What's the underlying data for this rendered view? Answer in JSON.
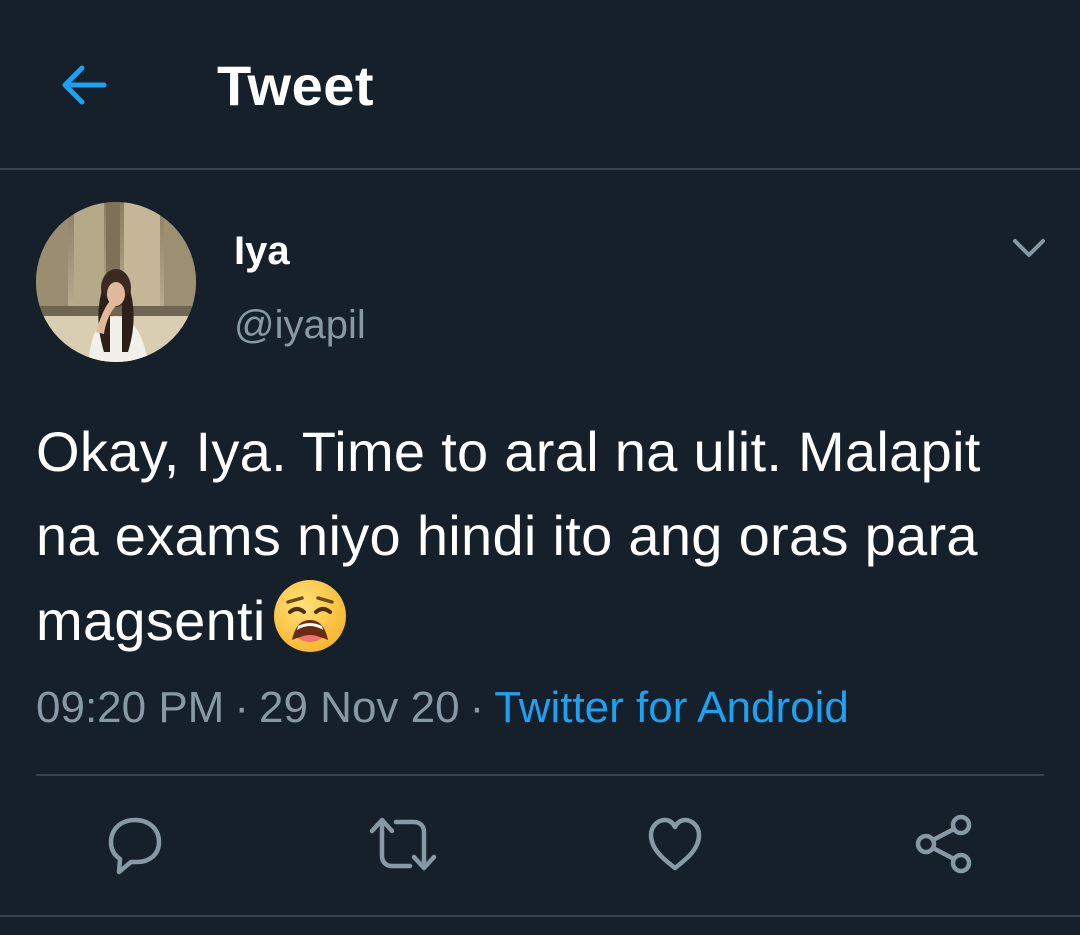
{
  "header": {
    "title": "Tweet",
    "back_icon": "arrow-left-icon"
  },
  "tweet": {
    "author": {
      "display_name": "Iya",
      "handle": "@iyapil",
      "avatar_icon": "profile-photo"
    },
    "text": "Okay, Iya. Time to aral na ulit. Malapit na exams niyo hindi ito ang oras para magsenti",
    "emoji": "weary-face-emoji",
    "time": "09:20 PM",
    "separator": "·",
    "date": "29 Nov 20",
    "source": "Twitter for Android",
    "menu_icon": "chevron-down-icon"
  },
  "actions": [
    {
      "name": "reply",
      "icon": "comment-icon"
    },
    {
      "name": "retweet",
      "icon": "retweet-icon"
    },
    {
      "name": "like",
      "icon": "heart-icon"
    },
    {
      "name": "share",
      "icon": "share-icon"
    }
  ],
  "colors": {
    "background": "#16202b",
    "accent": "#1da1f2",
    "secondary_text": "#8899a6",
    "divider": "#38444d"
  }
}
